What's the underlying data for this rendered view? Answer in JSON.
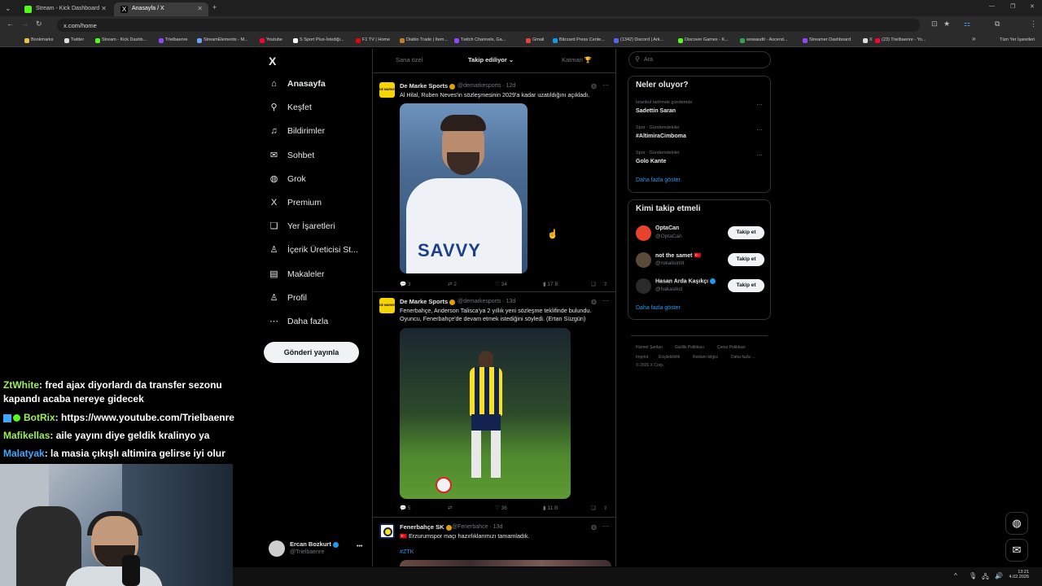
{
  "browser": {
    "tabs": [
      {
        "label": "Stream - Kick Dashboard",
        "active": false,
        "color": "#53fc18"
      },
      {
        "label": "Anasayfa / X",
        "active": true,
        "color": "#ffffff"
      }
    ],
    "url": "x.com/home",
    "bookmarks": [
      "Bookmarks",
      "Twitter",
      "Stream - Kick Dashb...",
      "Trielbaenre",
      "StreamElements - M...",
      "Youtube",
      "S Sport Plus-İstediği...",
      "F1 TV | Home",
      "Diablo Trade | Item...",
      "Twitch Channels, Ga...",
      "Gmail",
      "Blizzard Press Cente...",
      "(1342) Discord | Ark...",
      "Discover Games - K...",
      "wowaudit - Ascend...",
      "Streamer Dashboard",
      "X",
      "(23) Trielbaenre - Yo..."
    ],
    "bookmarks_more": "»",
    "all_bookmarks": "Tüm Yer İşaretleri"
  },
  "nav": {
    "logo": "X",
    "items": [
      {
        "label": "Anasayfa",
        "icon": "home-icon",
        "glyph": "⌂"
      },
      {
        "label": "Keşfet",
        "icon": "search-icon",
        "glyph": "⚲"
      },
      {
        "label": "Bildirimler",
        "icon": "bell-icon",
        "glyph": "♫"
      },
      {
        "label": "Sohbet",
        "icon": "mail-icon",
        "glyph": "✉"
      },
      {
        "label": "Grok",
        "icon": "grok-icon",
        "glyph": "◍"
      },
      {
        "label": "Premium",
        "icon": "x-logo-icon",
        "glyph": "X"
      },
      {
        "label": "Yer İşaretleri",
        "icon": "bookmark-icon",
        "glyph": "❏"
      },
      {
        "label": "İçerik Üreticisi St...",
        "icon": "creator-icon",
        "glyph": "♙"
      },
      {
        "label": "Makaleler",
        "icon": "articles-icon",
        "glyph": "▤"
      },
      {
        "label": "Profil",
        "icon": "profile-icon",
        "glyph": "♙"
      },
      {
        "label": "Daha fazla",
        "icon": "more-icon",
        "glyph": "⋯"
      }
    ],
    "post_button": "Gönderi yayınla",
    "account": {
      "name": "Ercan Bozkurt",
      "handle": "@Trielbaenre",
      "menu": "•••"
    }
  },
  "feed": {
    "tabs": [
      "Sana özel",
      "Takip ediliyor",
      "Katman 🏆"
    ],
    "active_tab": "Takip ediliyor",
    "tweets": [
      {
        "name": "De Marke Sports",
        "handle": "@demarkesports · 12d",
        "text": "Al Hilal, Ruben Neves'in sözleşmesinin 2029'a kadar uzatıldığını açıkladı.",
        "stats": {
          "replies": "3",
          "reposts": "2",
          "likes": "34",
          "views": "17 B"
        }
      },
      {
        "name": "De Marke Sports",
        "handle": "@demarkesports · 13d",
        "text": "Fenerbahçe, Anderson Talisca'ya 2 yıllık yeni sözleşme teklifinde bulundu. Oyuncu, Fenerbahçe'de devam etmek istediğini söyledi. (Ertan Süzgün)",
        "stats": {
          "replies": "5",
          "reposts": "",
          "likes": "36",
          "views": "11 B"
        }
      },
      {
        "name": "Fenerbahçe SK",
        "handle": "@Fenerbahce · 13d",
        "text": "🇹🇷 Erzurumspor maçı hazırlıklarımızı tamamladık.",
        "hashtag": "#ZTK"
      }
    ]
  },
  "right": {
    "search_placeholder": "Ara",
    "trends_title": "Neler oluyor?",
    "trends": [
      {
        "meta": "İstanbul tarihinde gündemde",
        "topic": "Sadettin Saran"
      },
      {
        "meta": "Spor · Gündemdekiler",
        "topic": "#AltimiraCimboma"
      },
      {
        "meta": "Spor · Gündemdekiler",
        "topic": "Golo Kante"
      }
    ],
    "trends_more": "Daha fazla göster",
    "follow_title": "Kimi takip etmeli",
    "follow": [
      {
        "name": "OptaCan",
        "handle": "@OptaCan",
        "button": "Takip et"
      },
      {
        "name": "not the samet 🇹🇷",
        "handle": "@rokalisimit",
        "button": "Takip et"
      },
      {
        "name": "Hasan Arda Kaşıkçı",
        "handle": "@hakasikci",
        "button": "Takip et"
      }
    ],
    "follow_more": "Daha fazla göster",
    "footer": [
      "Hizmet Şartları",
      "Gizlilik Politikası",
      "Çerez Politikası",
      "Imprint",
      "Erişilebilirlik",
      "Reklam bilgisi",
      "Daha fazla ...",
      "© 2026 X Corp."
    ]
  },
  "chat": [
    {
      "user": "ZtWhite",
      "color": "#9cf05a",
      "msg": ": fred ajax diyorlardı da transfer sezonu",
      "cont": "kapandı acaba nereye gidecek"
    },
    {
      "user": "BotRix",
      "color": "#9cf05a",
      "msg": ": https://www.youtube.com/Trielbaenre"
    },
    {
      "user": "Mafikellas",
      "color": "#9cf05a",
      "msg": ": aile yayını diye geldik kralinyo ya"
    },
    {
      "user": "Malatyak",
      "color": "#3fa7ff",
      "msg": ": la masia çıkışlı altimira gelirse iyi olur"
    }
  ],
  "taskbar": {
    "time": "13:21",
    "date": "4.02.2026"
  }
}
